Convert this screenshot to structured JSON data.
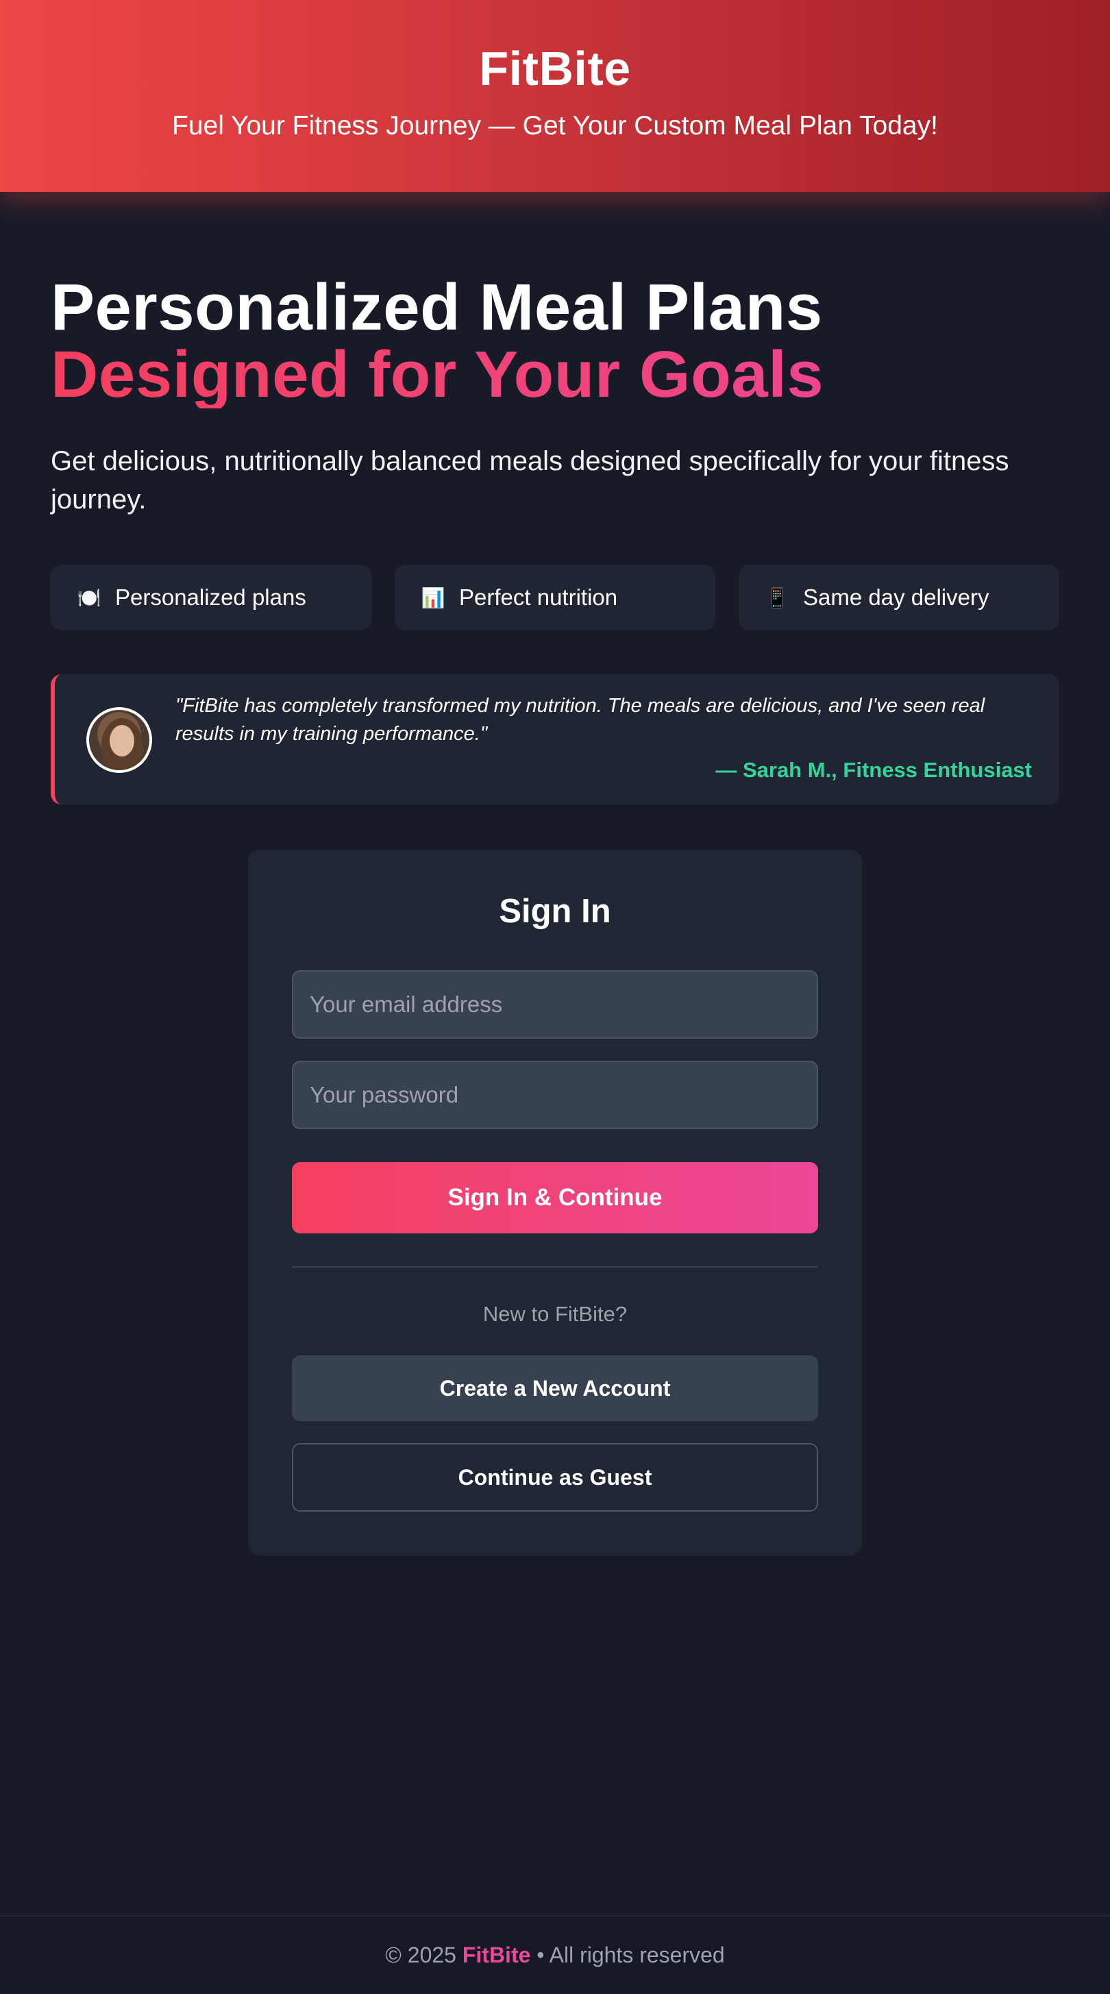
{
  "header": {
    "brand": "FitBite",
    "tagline": "Fuel Your Fitness Journey — Get Your Custom Meal Plan Today!"
  },
  "hero": {
    "title_line1": "Personalized Meal Plans",
    "title_line2": "Designed for Your Goals",
    "subtitle": "Get delicious, nutritionally balanced meals designed specifically for your fitness journey."
  },
  "features": [
    {
      "icon": "plate-icon",
      "glyph": "🍽️",
      "label": "Personalized plans"
    },
    {
      "icon": "bar-chart-icon",
      "glyph": "📊",
      "label": "Perfect nutrition"
    },
    {
      "icon": "phone-icon",
      "glyph": "📱",
      "label": "Same day delivery"
    }
  ],
  "testimonial": {
    "quote": "\"FitBite has completely transformed my nutrition. The meals are delicious, and I've seen real results in my training performance.\"",
    "author": "— Sarah M., Fitness Enthusiast"
  },
  "signin": {
    "title": "Sign In",
    "email_placeholder": "Your email address",
    "password_placeholder": "Your password",
    "submit_label": "Sign In & Continue",
    "new_prompt": "New to FitBite?",
    "create_label": "Create a New Account",
    "guest_label": "Continue as Guest"
  },
  "footer": {
    "prefix": "© 2025",
    "brand": "FitBite",
    "suffix": "• All rights reserved"
  },
  "colors": {
    "accent": "#f43f5e",
    "accent_pink": "#ec4899",
    "header_start": "#ef4646",
    "header_end": "#9f1f26",
    "testimonial_author": "#34d399",
    "background": "#181b27"
  }
}
